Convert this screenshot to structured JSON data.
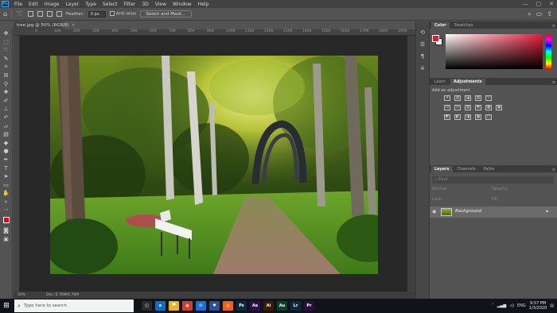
{
  "menubar": {
    "logo": "Ps",
    "items": [
      "File",
      "Edit",
      "Image",
      "Layer",
      "Type",
      "Select",
      "Filter",
      "3D",
      "View",
      "Window",
      "Help"
    ],
    "window_controls": [
      "—",
      "▢",
      "✕"
    ]
  },
  "options": {
    "feather_label": "Feather:",
    "feather_value": "0 px",
    "antialias_label": "Anti-alias",
    "select_mask_label": "Select and Mask..."
  },
  "document": {
    "tab_title": "tree.jpg @ 50% (RGB/8)",
    "tab_close": "×",
    "ruler_ticks": [
      "0",
      "100",
      "200",
      "300",
      "400",
      "500",
      "600",
      "700",
      "800",
      "900",
      "1000",
      "1100",
      "1200",
      "1300",
      "1400",
      "1500",
      "1600",
      "1700",
      "1800",
      "1900"
    ],
    "zoom": "50%",
    "doc_info": "Doc: 6.76M/6.76M"
  },
  "panels": {
    "color_tabs": [
      "Color",
      "Swatches"
    ],
    "adj_tabs": [
      "Learn",
      "Adjustments"
    ],
    "adj_header": "Add an adjustment",
    "adj_row1": [
      "☀",
      "▥",
      "◪",
      "▤",
      "▽"
    ],
    "adj_row2": [
      "⊡",
      "⊙",
      "▨",
      "◓",
      "▦",
      "▣"
    ],
    "adj_row3": [
      "◩",
      "◧",
      "◨",
      "▩",
      "▢"
    ],
    "layers_tabs": [
      "Layers",
      "Channels",
      "Paths"
    ],
    "layers_kind": "Kind",
    "layers_blend": "Normal",
    "layers_opacity": "Opacity:",
    "layers_lock": "Lock:",
    "layers_fill": "Fill:",
    "layer_name": "Background"
  },
  "taskbar": {
    "start": "⊞",
    "search_placeholder": "Type here to search",
    "apps": [
      {
        "label": "◫",
        "color": "#2b2b2b"
      },
      {
        "label": "e",
        "color": "#0b6ec2"
      },
      {
        "label": "▀",
        "color": "#e8b620"
      },
      {
        "label": "◉",
        "color": "#d33c2c"
      },
      {
        "label": "✉",
        "color": "#1f6fd0"
      },
      {
        "label": "♥",
        "color": "#2a4f9c"
      },
      {
        "label": "◎",
        "color": "#e8641c"
      },
      {
        "label": "Ps",
        "color": "#0a2a44"
      },
      {
        "label": "Ae",
        "color": "#2a1149"
      },
      {
        "label": "Ai",
        "color": "#3b1a00"
      },
      {
        "label": "Au",
        "color": "#103d34"
      },
      {
        "label": "Lr",
        "color": "#0d2a3d"
      },
      {
        "label": "Pr",
        "color": "#2a0f3a"
      }
    ],
    "language": "ENG",
    "time": "9:57 PM",
    "date": "1/3/2020"
  }
}
